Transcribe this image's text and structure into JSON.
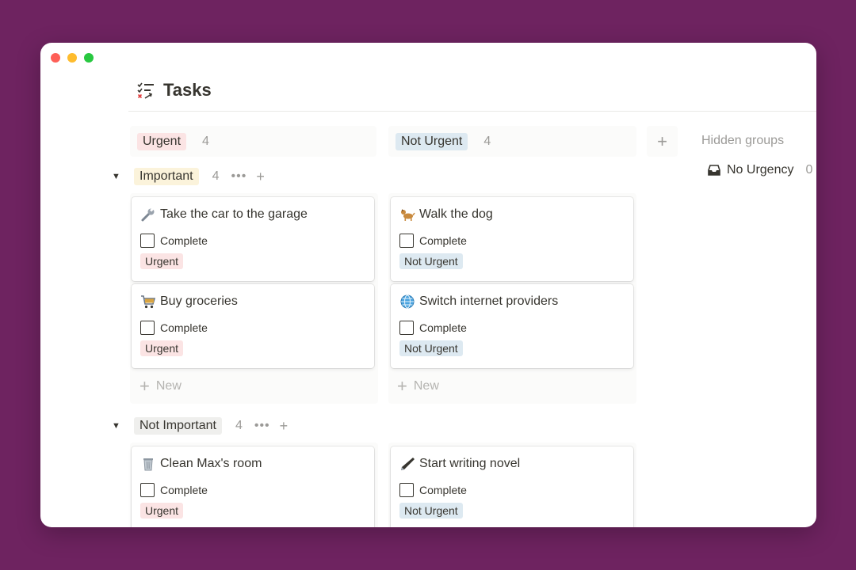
{
  "page": {
    "title": "Tasks"
  },
  "columns": [
    {
      "label": "Urgent",
      "count": "4"
    },
    {
      "label": "Not Urgent",
      "count": "4"
    }
  ],
  "add_column_label": "+",
  "hidden": {
    "label": "Hidden groups",
    "item_label": "No Urgency",
    "item_count": "0"
  },
  "groups": [
    {
      "label": "Important",
      "count": "4",
      "actions": "•••",
      "add": "+"
    },
    {
      "label": "Not Important",
      "count": "4",
      "actions": "•••",
      "add": "+"
    }
  ],
  "cards": [
    {
      "emoji": "wrench",
      "title": "Take the car to the garage",
      "check_label": "Complete",
      "tag": "Urgent"
    },
    {
      "emoji": "dog",
      "title": "Walk the dog",
      "check_label": "Complete",
      "tag": "Not Urgent"
    },
    {
      "emoji": "cart",
      "title": "Buy groceries",
      "check_label": "Complete",
      "tag": "Urgent"
    },
    {
      "emoji": "globe",
      "title": "Switch internet providers",
      "check_label": "Complete",
      "tag": "Not Urgent"
    },
    {
      "emoji": "wastebasket",
      "title": "Clean Max's room",
      "check_label": "Complete",
      "tag": "Urgent"
    },
    {
      "emoji": "pen",
      "title": "Start writing novel",
      "check_label": "Complete",
      "tag": "Not Urgent"
    }
  ],
  "new_label": "New",
  "colors": {
    "urgent_tag": "#fbe4e4",
    "not_urgent_tag": "#dde9f1",
    "important_tag": "#fbf3db",
    "not_important_tag": "#efefed"
  }
}
